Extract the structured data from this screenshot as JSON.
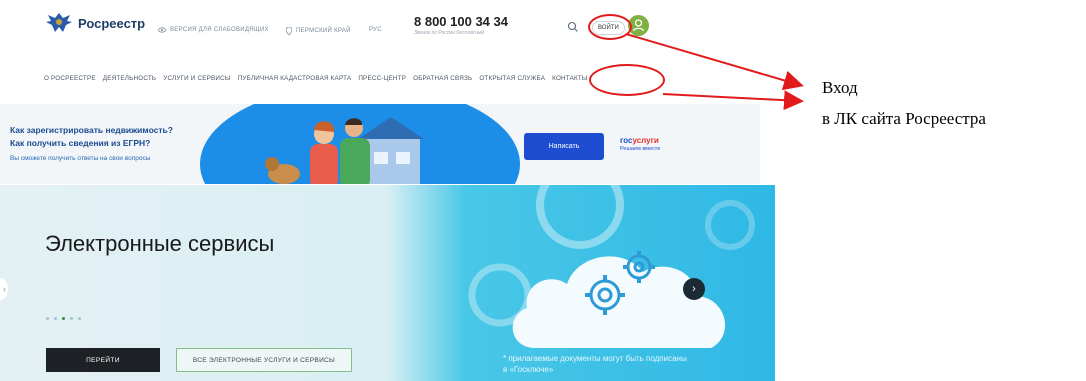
{
  "header": {
    "logo_text": "Росреестр",
    "accessibility": "ВЕРСИЯ ДЛЯ СЛАБОВИДЯЩИХ",
    "region": "ПЕРМСКИЙ КРАЙ",
    "lang": "РУС",
    "phone": "8 800 100 34 34",
    "phone_sub": "Звонок по России бесплатный",
    "login": "ВОЙТИ"
  },
  "nav": {
    "items": [
      "О РОСРЕЕСТРЕ",
      "ДЕЯТЕЛЬНОСТЬ",
      "УСЛУГИ И СЕРВИСЫ",
      "ПУБЛИЧНАЯ КАДАСТРОВАЯ КАРТА",
      "ПРЕСС-ЦЕНТР",
      "ОБРАТНАЯ СВЯЗЬ",
      "ОТКРЫТАЯ СЛУЖБА",
      "КОНТАКТЫ"
    ]
  },
  "banner": {
    "q1": "Как зарегистрировать недвижимость?",
    "q2": "Как получить сведения из ЕГРН?",
    "sub": "Вы сможете получить ответы на свои вопросы",
    "button": "Написать",
    "gos_a": "гос",
    "gos_b": "услуги",
    "gos_sub": "Решаем вместе"
  },
  "hero": {
    "title": "Электронные сервисы",
    "btn_go": "ПЕРЕЙТИ",
    "btn_all": "ВСЕ ЭЛЕКТРОННЫЕ УСЛУГИ И СЕРВИСЫ",
    "note1": "* прилагаемые документы могут быть подписаны",
    "note2": "в «Госключе»",
    "next": "›",
    "prev": "‹"
  },
  "annotation": {
    "line1": "Вход",
    "line2": "в ЛК сайта Росреестра"
  },
  "colors": {
    "annotation_red": "#e11b1b",
    "brand_blue": "#1e4dd1",
    "avatar_green": "#7fb042"
  },
  "icons": [
    "eagle-logo-icon",
    "eye-icon",
    "location-pin-icon",
    "search-icon",
    "user-icon",
    "chevron-right-icon",
    "chevron-left-icon",
    "gear-icon",
    "cloud-icon"
  ]
}
